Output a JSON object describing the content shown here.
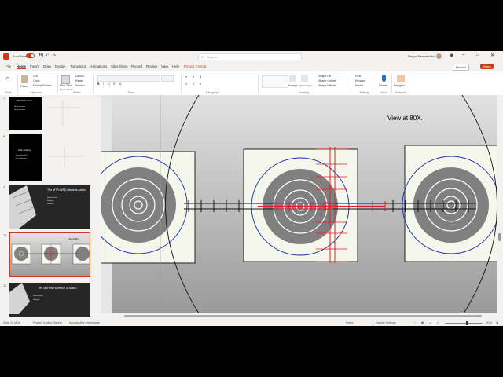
{
  "titlebar": {
    "autosave_label": "AutoSave",
    "autosave_state": "On",
    "search_placeholder": "Search",
    "user_name": "Denys Kwaselenko"
  },
  "menu": {
    "tabs": [
      {
        "label": "File"
      },
      {
        "label": "Home"
      },
      {
        "label": "Insert"
      },
      {
        "label": "Draw"
      },
      {
        "label": "Design"
      },
      {
        "label": "Transitions"
      },
      {
        "label": "Animations"
      },
      {
        "label": "Slide Show"
      },
      {
        "label": "Record"
      },
      {
        "label": "Review"
      },
      {
        "label": "View"
      },
      {
        "label": "Help"
      },
      {
        "label": "Picture Format"
      }
    ],
    "active_tab": "Home",
    "record_label": "Record",
    "share_label": "Share"
  },
  "ribbon": {
    "paste_label": "Paste",
    "cut_label": "Cut",
    "copy_label": "Copy",
    "format_painter_label": "Format Painter",
    "new_slide_label": "New Slide",
    "reuse_slides_label": "Reuse Slides",
    "layout_label": "Layout",
    "reset_label": "Reset",
    "section_label": "Section",
    "arrange_label": "Arrange",
    "quick_styles_label": "Quick Styles",
    "shape_fill_label": "Shape Fill",
    "shape_outline_label": "Shape Outline",
    "shape_effects_label": "Shape Effects",
    "find_label": "Find",
    "replace_label": "Replace",
    "select_label": "Select",
    "dictate_label": "Dictate",
    "designer_label": "Designer",
    "groups": {
      "undo": "Undo",
      "clipboard": "Clipboard",
      "slides": "Slides",
      "font": "Font",
      "paragraph": "Paragraph",
      "drawing": "Drawing",
      "editing": "Editing",
      "voice": "Voice",
      "designer": "Designer"
    }
  },
  "thumbnails": [
    {
      "number": "7",
      "title": "MTR-WFD reticle",
      "bullets": [
        "No subtension",
        "No guesswork"
      ]
    },
    {
      "number": "8",
      "title": "Inner workings",
      "bullets": [
        "Mirrored reticle",
        "No subtension"
      ]
    },
    {
      "number": "9",
      "title": "The MTR-WFD reticle is Action",
      "bullets": [
        "Mil-dot reticle",
        "Ranging",
        "Holdover"
      ]
    },
    {
      "number": "10",
      "title": "",
      "bullets": []
    },
    {
      "number": "11",
      "title": "The MTR-WFD reticle in Action",
      "bullets": [
        "Mil-dot reticle",
        "Ranging"
      ]
    }
  ],
  "slide": {
    "annotation": "View at 80X."
  },
  "status": {
    "slide_counter": "Slide 10 of 16",
    "language": "English (United States)",
    "accessibility": "Accessibility: Investigate",
    "notes_label": "Notes",
    "display_settings": "Display Settings",
    "zoom": "61%"
  },
  "colors": {
    "accent": "#c43e1c",
    "target_dark": "#808080",
    "target_ring": "#1a2bb0",
    "reticle_red": "#e52222",
    "slide_bg_top": "#e2e2e2",
    "slide_bg_bottom": "#9a9a9a"
  }
}
